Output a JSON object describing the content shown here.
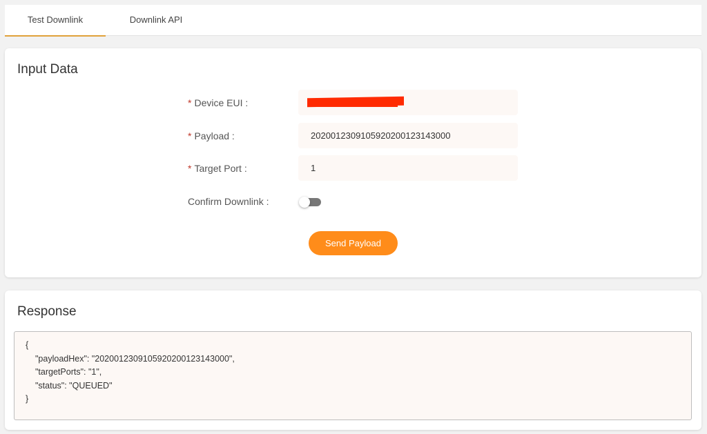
{
  "tabs": [
    {
      "label": "Test Downlink",
      "active": true
    },
    {
      "label": "Downlink API",
      "active": false
    }
  ],
  "input_card": {
    "title": "Input Data",
    "required_marker": "*",
    "device_eui": {
      "label": "Device EUI :",
      "value": ""
    },
    "payload": {
      "label": "Payload :",
      "value": "20200123091059202001231430​00"
    },
    "target_port": {
      "label": "Target Port :",
      "value": "1"
    },
    "confirm_downlink": {
      "label": "Confirm Downlink :",
      "enabled": false
    },
    "send_button": "Send Payload"
  },
  "response_card": {
    "title": "Response",
    "lines": {
      "open": "{",
      "payload_hex": "\"payloadHex\": \"2020012309105920200123143000\",",
      "target_ports": "\"targetPorts\": \"1\",",
      "status": "\"status\": \"QUEUED\"",
      "close": "}"
    }
  },
  "colors": {
    "accent": "#ff8c1a",
    "tab_underline": "#e0a13a",
    "required": "#c0392b",
    "redaction": "#ff2a00"
  }
}
